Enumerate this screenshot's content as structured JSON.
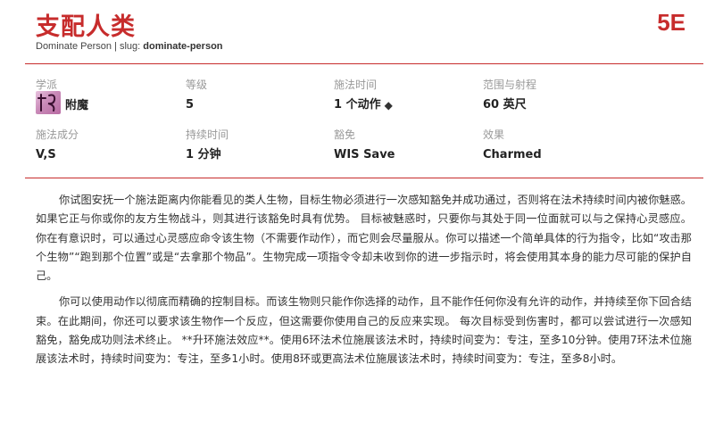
{
  "header": {
    "title": "支配人类",
    "edition": "5E",
    "english_name": "Dominate Person",
    "slug_label": "| slug:",
    "slug": "dominate-person"
  },
  "stats": {
    "school_label": "学派",
    "school_value": "附魔",
    "level_label": "等级",
    "level_value": "5",
    "casting_time_label": "施法时间",
    "casting_time_value": "1 个动作",
    "ritual_icon": "diamond-icon",
    "range_label": "范围与射程",
    "range_value": "60 英尺",
    "components_label": "施法成分",
    "components_value": "V,S",
    "duration_label": "持续时间",
    "duration_value": "1 分钟",
    "save_label": "豁免",
    "save_value": "WIS Save",
    "effect_label": "效果",
    "effect_value": "Charmed"
  },
  "description": {
    "p1": "你试图安抚一个施法距离内你能看见的类人生物，目标生物必须进行一次感知豁免并成功通过，否则将在法术持续时间内被你魅惑。如果它正与你或你的友方生物战斗，则其进行该豁免时具有优势。 目标被魅惑时，只要你与其处于同一位面就可以与之保持心灵感应。你在有意识时，可以通过心灵感应命令该生物（不需要作动作），而它则会尽量服从。你可以描述一个简单具体的行为指令，比如“攻击那个生物”“跑到那个位置”或是“去拿那个物品”。生物完成一项指令令却未收到你的进一步指示时，将会使用其本身的能力尽可能的保护自己。",
    "p2": "你可以使用动作以彻底而精确的控制目标。而该生物则只能作你选择的动作，且不能作任何你没有允许的动作，并持续至你下回合结束。在此期间，你还可以要求该生物作一个反应，但这需要你使用自己的反应来实现。 每次目标受到伤害时，都可以尝试进行一次感知豁免，豁免成功则法术终止。 **升环施法效应**。使用6环法术位施展该法术时，持续时间变为：专注，至多10分钟。使用7环法术位施展该法术时，持续时间变为：专注，至多1小时。使用8环或更高法术位施展该法术时，持续时间变为：专注，至多8小时。"
  },
  "colors": {
    "accent": "#c72c2c",
    "label": "#999999"
  }
}
